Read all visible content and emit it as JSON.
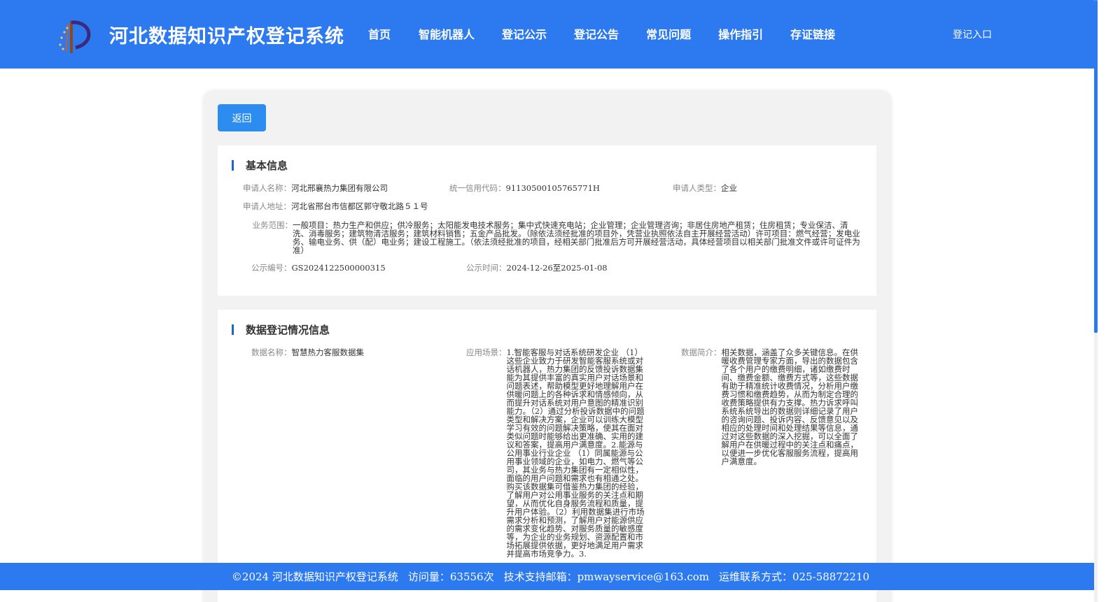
{
  "header": {
    "site_title": "河北数据知识产权登记系统",
    "logo_icon": "emblem-logo-icon",
    "nav_items": [
      "首页",
      "智能机器人",
      "登记公示",
      "登记公告",
      "常见问题",
      "操作指引",
      "存证链接"
    ],
    "login_label": "登记入口"
  },
  "toolbar": {
    "back_label": "返回"
  },
  "basic_info": {
    "title": "基本信息",
    "applicant_name_label": "申请人名称：",
    "applicant_name": "河北邢襄热力集团有限公司",
    "credit_code_label": "统一信用代码：",
    "credit_code": "91130500105765771H",
    "applicant_type_label": "申请人类型：",
    "applicant_type": "企业",
    "address_label": "申请人地址：",
    "address": "河北省邢台市信都区郭守敬北路５１号",
    "business_scope_label": "业务范围：",
    "business_scope": "一般项目：热力生产和供应；供冷服务；太阳能发电技术服务；集中式快速充电站；企业管理；企业管理咨询；非居住房地产租赁；住房租赁；专业保洁、清洗、消毒服务；建筑物清洁服务；建筑材料销售；五金产品批发。（除依法须经批准的项目外，凭营业执照依法自主开展经营活动）许可项目：燃气经营；发电业务、输电业务、供（配）电业务；建设工程施工。（依法须经批准的项目，经相关部门批准后方可开展经营活动，具体经营项目以相关部门批准文件或许可证件为准）",
    "notice_no_label": "公示编号：",
    "notice_no": "GS2024122500000315",
    "notice_time_label": "公示时间：",
    "notice_time": "2024-12-26至2025-01-08"
  },
  "data_info": {
    "title": "数据登记情况信息",
    "data_name_label": "数据名称：",
    "data_name": "智慧热力客服数据集",
    "scenario_label": "应用场景：",
    "scenario": "1.智能客服与对话系统研发企业 （1）这些企业致力于研发智能客服系统或对话机器人，热力集团的反馈投诉数据集能为其提供丰富的真实用户对话场景和问题表述，帮助模型更好地理解用户在供暖问题上的各种诉求和情感倾向，从而提升对话系统对用户意图的精准识别能力。（2）通过分析投诉数据中的问题类型和解决方案，企业可以训练大模型学习有效的问题解决策略，使其在面对类似问题时能够给出更准确、实用的建议和答案，提高用户满意度。2.能源与公用事业行业企业 （1）同属能源与公用事业领域的企业，如电力、燃气等公司，其业务与热力集团有一定相似性，面临的用户问题和需求也有相通之处。购买该数据集可借鉴热力集团的经验，了解用户对公用事业服务的关注点和期望，从而优化自身服务流程和质量，提升用户体验。（2）利用数据集进行市场需求分析和预测，了解用户对能源供应的需求变化趋势、对服务质量的敏感度等，为企业的业务规划、资源配置和市场拓展提供依据，更好地满足用户需求并提高市场竞争力。3.",
    "intro_label": "数据简介：",
    "intro": "相关数据，涵盖了众多关键信息。在供暖收费管理专家方面，导出的数据包含了各个用户的缴费明细，诸如缴费时间、缴费金额、缴费方式等，这些数据有助于精准统计收费情况，分析用户缴费习惯和缴费趋势，从而为制定合理的收费策略提供有力支撑。热力诉求呼叫系统系统导出的数据则详细记录了用户的咨询问题、投诉内容、反馈意见以及相应的处理时间和处理结果等信息，通过对这些数据的深入挖掘，可以全面了解用户在供暖过程中的关注点和痛点，以便进一步优化客服服务流程，提高用户满意度。"
  },
  "footer": {
    "copyright": "©2024 河北数据知识产权登记系统",
    "visits": "访问量：63556次",
    "support": "技术支持邮箱：pmwayservice@163.com",
    "contact": "运维联系方式：025-58872210"
  },
  "colors": {
    "header_bg": "#2c79f0",
    "button_bg": "#2c8cf0",
    "accent_bar": "#1f64c8"
  }
}
